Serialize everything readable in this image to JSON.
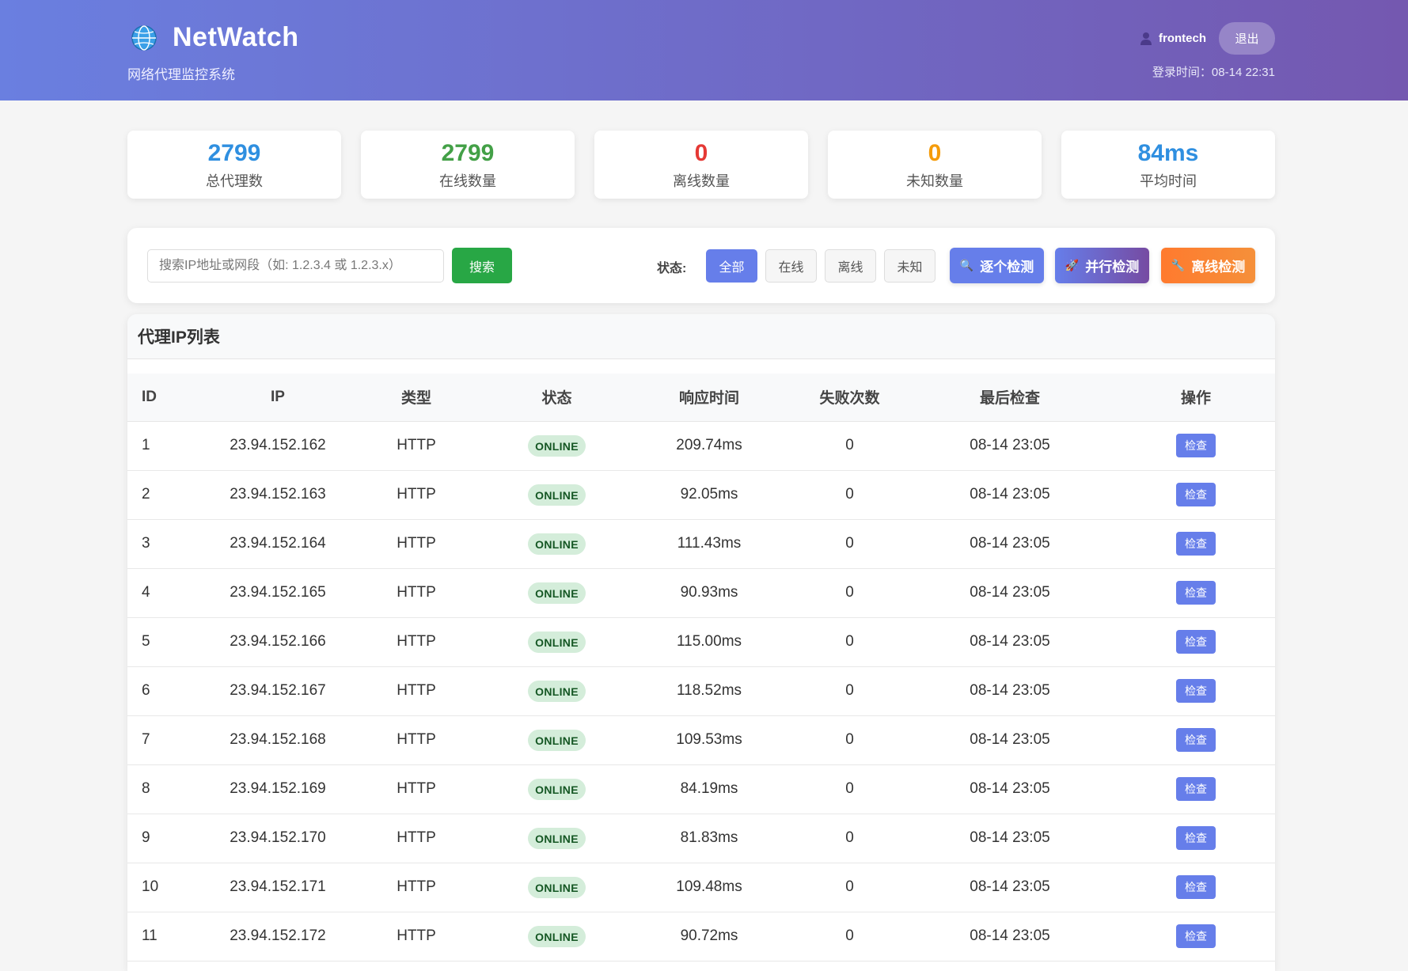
{
  "header": {
    "title": "NetWatch",
    "subtitle": "网络代理监控系统",
    "username": "frontech",
    "logout_label": "退出",
    "login_time": "登录时间：08-14 22:31"
  },
  "stats": [
    {
      "value": "2799",
      "label": "总代理数",
      "color": "#2f8fe0"
    },
    {
      "value": "2799",
      "label": "在线数量",
      "color": "#43a047"
    },
    {
      "value": "0",
      "label": "离线数量",
      "color": "#e53935"
    },
    {
      "value": "0",
      "label": "未知数量",
      "color": "#f59c0b"
    },
    {
      "value": "84ms",
      "label": "平均时间",
      "color": "#2f8fe0"
    }
  ],
  "toolbar": {
    "search_placeholder": "搜索IP地址或网段（如: 1.2.3.4 或 1.2.3.x）",
    "search_label": "搜索",
    "status_label": "状态:",
    "filters": [
      "全部",
      "在线",
      "离线",
      "未知"
    ],
    "active_filter": "全部",
    "actions": [
      {
        "label": "逐个检测",
        "icon": "magnifier-icon",
        "color": "#667eea"
      },
      {
        "label": "并行检测",
        "icon": "rocket-icon",
        "color": "#7b55c9"
      },
      {
        "label": "离线检测",
        "icon": "wrench-icon",
        "color": "#f57c2a"
      }
    ]
  },
  "table": {
    "title": "代理IP列表",
    "columns": [
      "ID",
      "IP",
      "类型",
      "状态",
      "响应时间",
      "失败次数",
      "最后检查",
      "操作"
    ],
    "check_label": "检查",
    "rows": [
      {
        "id": "1",
        "ip": "23.94.152.162",
        "type": "HTTP",
        "status": "ONLINE",
        "response": "209.74ms",
        "fails": "0",
        "last": "08-14 23:05"
      },
      {
        "id": "2",
        "ip": "23.94.152.163",
        "type": "HTTP",
        "status": "ONLINE",
        "response": "92.05ms",
        "fails": "0",
        "last": "08-14 23:05"
      },
      {
        "id": "3",
        "ip": "23.94.152.164",
        "type": "HTTP",
        "status": "ONLINE",
        "response": "111.43ms",
        "fails": "0",
        "last": "08-14 23:05"
      },
      {
        "id": "4",
        "ip": "23.94.152.165",
        "type": "HTTP",
        "status": "ONLINE",
        "response": "90.93ms",
        "fails": "0",
        "last": "08-14 23:05"
      },
      {
        "id": "5",
        "ip": "23.94.152.166",
        "type": "HTTP",
        "status": "ONLINE",
        "response": "115.00ms",
        "fails": "0",
        "last": "08-14 23:05"
      },
      {
        "id": "6",
        "ip": "23.94.152.167",
        "type": "HTTP",
        "status": "ONLINE",
        "response": "118.52ms",
        "fails": "0",
        "last": "08-14 23:05"
      },
      {
        "id": "7",
        "ip": "23.94.152.168",
        "type": "HTTP",
        "status": "ONLINE",
        "response": "109.53ms",
        "fails": "0",
        "last": "08-14 23:05"
      },
      {
        "id": "8",
        "ip": "23.94.152.169",
        "type": "HTTP",
        "status": "ONLINE",
        "response": "84.19ms",
        "fails": "0",
        "last": "08-14 23:05"
      },
      {
        "id": "9",
        "ip": "23.94.152.170",
        "type": "HTTP",
        "status": "ONLINE",
        "response": "81.83ms",
        "fails": "0",
        "last": "08-14 23:05"
      },
      {
        "id": "10",
        "ip": "23.94.152.171",
        "type": "HTTP",
        "status": "ONLINE",
        "response": "109.48ms",
        "fails": "0",
        "last": "08-14 23:05"
      },
      {
        "id": "11",
        "ip": "23.94.152.172",
        "type": "HTTP",
        "status": "ONLINE",
        "response": "90.72ms",
        "fails": "0",
        "last": "08-14 23:05"
      }
    ]
  }
}
